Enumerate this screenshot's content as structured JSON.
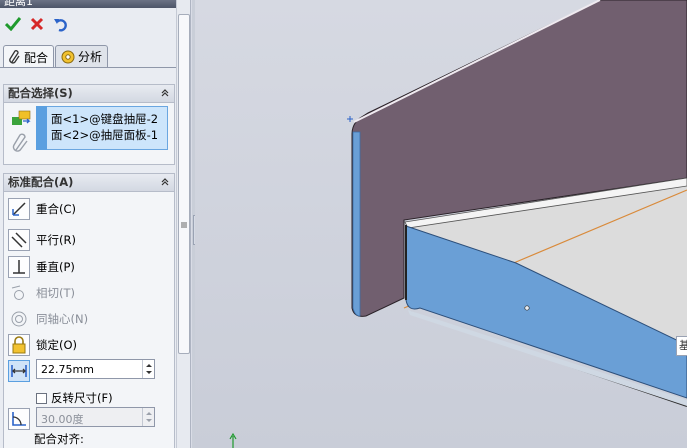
{
  "window": {
    "title": "距离1"
  },
  "actions": {
    "ok": "check-icon",
    "cancel": "close-icon",
    "undo": "undo-icon"
  },
  "tabs": [
    {
      "label": "配合",
      "icon": "paperclip-icon",
      "active": true
    },
    {
      "label": "分析",
      "icon": "analysis-icon",
      "active": false
    }
  ],
  "mate_selections": {
    "header": "配合选择(S)",
    "items": [
      "面<1>@键盘抽屉-2",
      "面<2>@抽屉面板-1"
    ]
  },
  "standard_mates": {
    "header": "标准配合(A)",
    "items": [
      {
        "label": "重合(C)",
        "icon": "coincident-icon",
        "enabled": true
      },
      {
        "label": "平行(R)",
        "icon": "parallel-icon",
        "enabled": true
      },
      {
        "label": "垂直(P)",
        "icon": "perpendicular-icon",
        "enabled": true
      },
      {
        "label": "相切(T)",
        "icon": "tangent-icon",
        "enabled": false
      },
      {
        "label": "同轴心(N)",
        "icon": "concentric-icon",
        "enabled": false
      },
      {
        "label": "锁定(O)",
        "icon": "lock-icon",
        "enabled": true
      }
    ],
    "distance": {
      "value": "22.75mm",
      "icon": "distance-icon",
      "selected": true
    },
    "flip_dimension": {
      "label": "反转尺寸(F)",
      "checked": false
    },
    "angle": {
      "value": "30.00度",
      "icon": "angle-icon",
      "enabled": false
    },
    "alignment_label": "配合对齐:"
  },
  "viewport": {
    "tooltip_char": "基"
  },
  "colors": {
    "panel_plate": "#715f6f",
    "selected_face": "#6a9fd6",
    "drawer_floor": "#dcdcdc",
    "edge_orange": "#d98a3a"
  }
}
